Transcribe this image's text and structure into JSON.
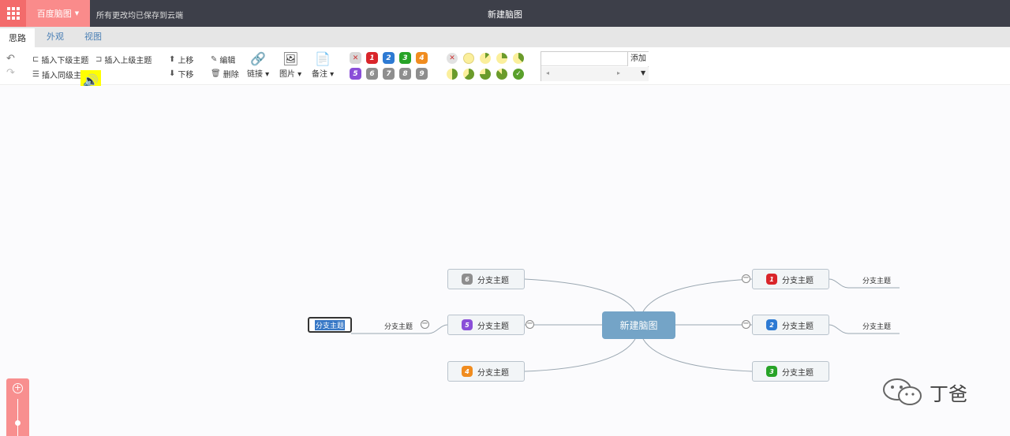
{
  "header": {
    "brand": "百度脑图",
    "saved_status": "所有更改均已保存到云端",
    "doc_title": "新建脑图"
  },
  "tabs": [
    {
      "label": "思路",
      "active": true
    },
    {
      "label": "外观",
      "active": false
    },
    {
      "label": "视图",
      "active": false
    }
  ],
  "toolbar": {
    "insert_child": "插入下级主题",
    "insert_parent": "插入上级主题",
    "insert_sibling": "插入同级主题",
    "move_up": "上移",
    "move_down": "下移",
    "edit": "编辑",
    "delete": "删除",
    "link": "链接",
    "image": "图片",
    "note": "备注",
    "priorities": [
      {
        "label": "✕",
        "color": "#d8d8d8",
        "text_color": "#c33"
      },
      {
        "label": "1",
        "color": "#d9252a"
      },
      {
        "label": "2",
        "color": "#2d7ad3"
      },
      {
        "label": "3",
        "color": "#27a327"
      },
      {
        "label": "4",
        "color": "#f08c1f"
      },
      {
        "label": "5",
        "color": "#8a4ed8"
      },
      {
        "label": "6",
        "color": "#8e8e8e"
      },
      {
        "label": "7",
        "color": "#8e8e8e"
      },
      {
        "label": "8",
        "color": "#8e8e8e"
      },
      {
        "label": "9",
        "color": "#8e8e8e"
      }
    ],
    "progress_levels": [
      "clear",
      "0",
      "1/8",
      "2/8",
      "3/8",
      "4/8",
      "5/8",
      "6/8",
      "7/8",
      "done"
    ],
    "tag_add": "添加"
  },
  "mindmap": {
    "root": "新建脑图",
    "nodes": [
      {
        "label": "分支主题",
        "priority": "6",
        "color": "#8e8e8e"
      },
      {
        "label": "分支主题",
        "priority": "5",
        "color": "#8a4ed8"
      },
      {
        "label": "分支主题",
        "priority": "4",
        "color": "#f08c1f"
      },
      {
        "label": "分支主题",
        "priority": "1",
        "color": "#d9252a"
      },
      {
        "label": "分支主题",
        "priority": "2",
        "color": "#2d7ad3"
      },
      {
        "label": "分支主题",
        "priority": "3",
        "color": "#27a327"
      }
    ],
    "leaves": [
      "分支主题",
      "分支主题",
      "分支主题"
    ],
    "editing_text": "分支主题"
  },
  "watermark": "丁爸"
}
